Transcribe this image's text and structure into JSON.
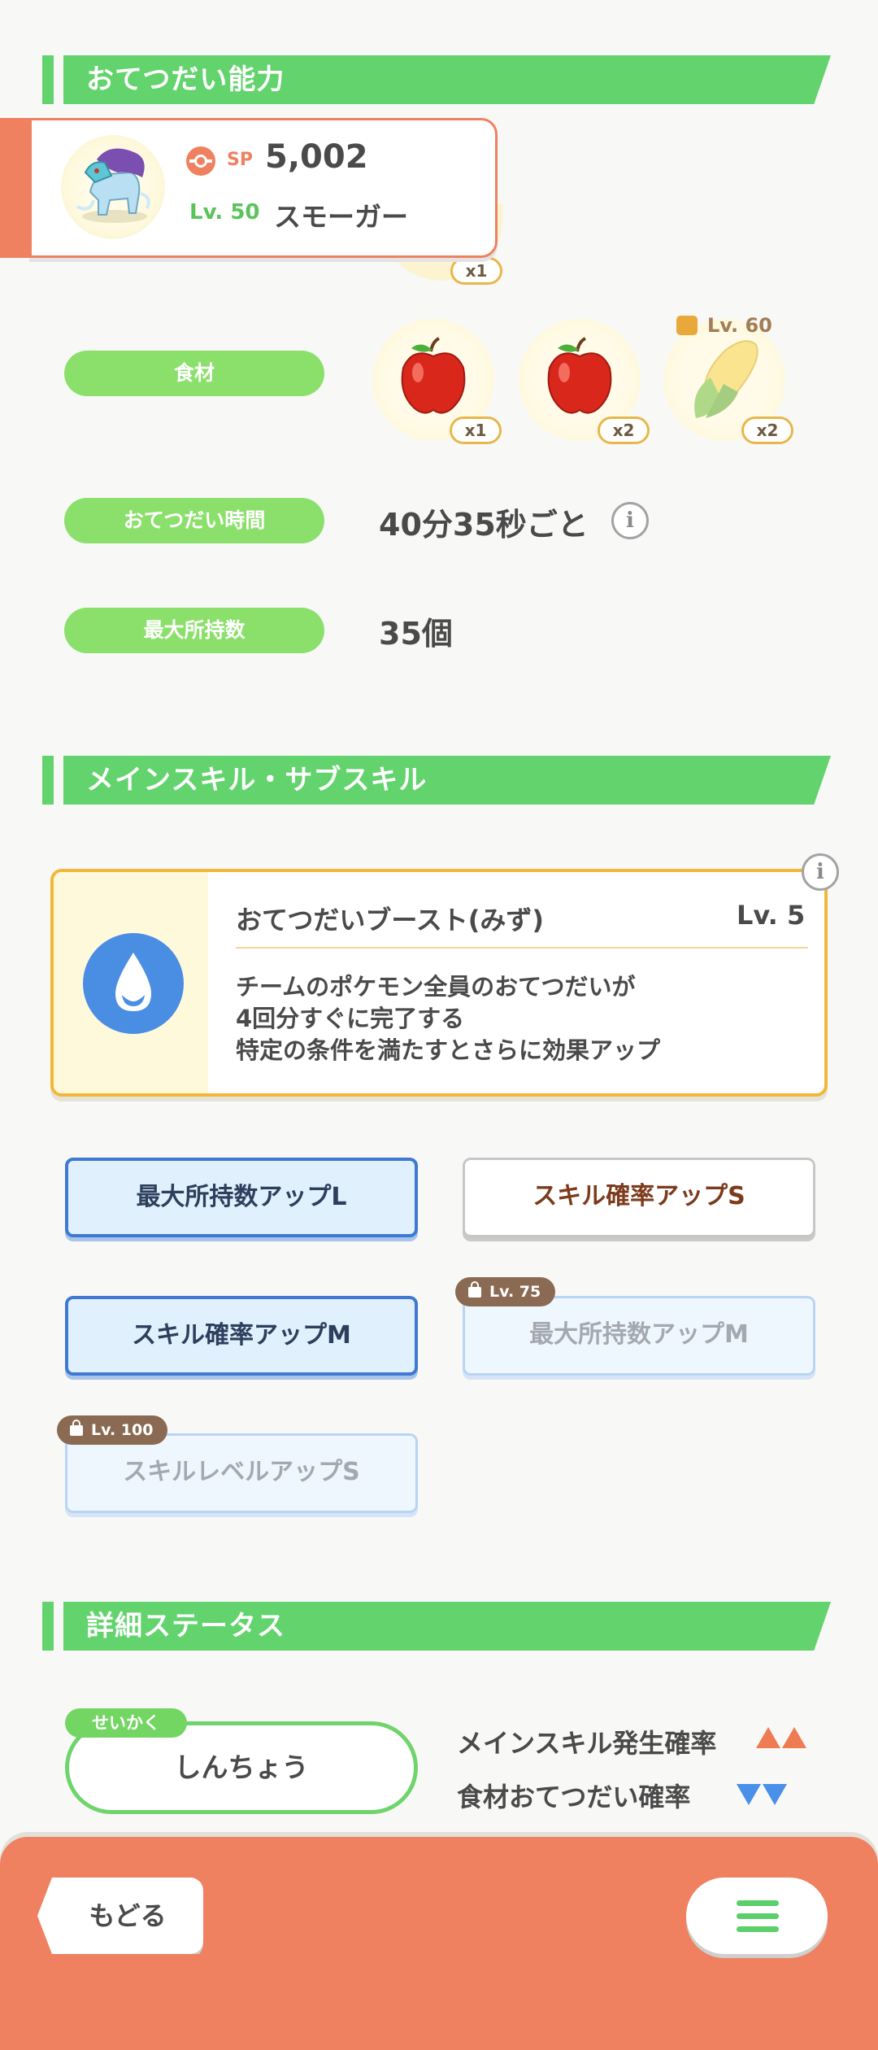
{
  "sections": {
    "ability_title": "おてつだい能力",
    "skills_title": "メインスキル・サブスキル",
    "details_title": "詳細ステータス"
  },
  "pokemon": {
    "sp_label": "SP",
    "sp_value": "5,002",
    "level": "Lv. 50",
    "name": "スモーガー"
  },
  "berry_peek_count": "x1",
  "ingredients": {
    "label": "食材",
    "items": [
      {
        "icon": "apple-icon",
        "count": "x1"
      },
      {
        "icon": "apple-icon",
        "count": "x2"
      },
      {
        "icon": "corn-icon",
        "count": "x2",
        "lock_level": "Lv. 60"
      }
    ]
  },
  "help_time": {
    "label": "おてつだい時間",
    "value": "40分35秒ごと"
  },
  "max_carry": {
    "label": "最大所持数",
    "value": "35個"
  },
  "main_skill": {
    "name": "おてつだいブースト(みず)",
    "level": "Lv. 5",
    "desc1": "チームのポケモン全員のおてつだいが",
    "desc2": "4回分すぐに完了する",
    "desc3": "特定の条件を満たすとさらに効果アップ"
  },
  "sub_skills": [
    {
      "label": "最大所持数アップL",
      "state": "active"
    },
    {
      "label": "スキル確率アップS",
      "state": "white"
    },
    {
      "label": "スキル確率アップM",
      "state": "active"
    },
    {
      "label": "最大所持数アップM",
      "state": "locked",
      "lock_level": "Lv. 75"
    },
    {
      "label": "スキルレベルアップS",
      "state": "locked",
      "lock_level": "Lv. 100"
    }
  ],
  "nature": {
    "tag": "せいかく",
    "name": "しんちょう",
    "up_label": "メインスキル発生確率",
    "down_label": "食材おてつだい確率"
  },
  "footer": {
    "back_label": "もどる"
  },
  "colors": {
    "green": "#62d36d",
    "orange": "#ef8160",
    "blue": "#3f79d4",
    "up": "#ee7b52",
    "down": "#4a8fe8"
  }
}
